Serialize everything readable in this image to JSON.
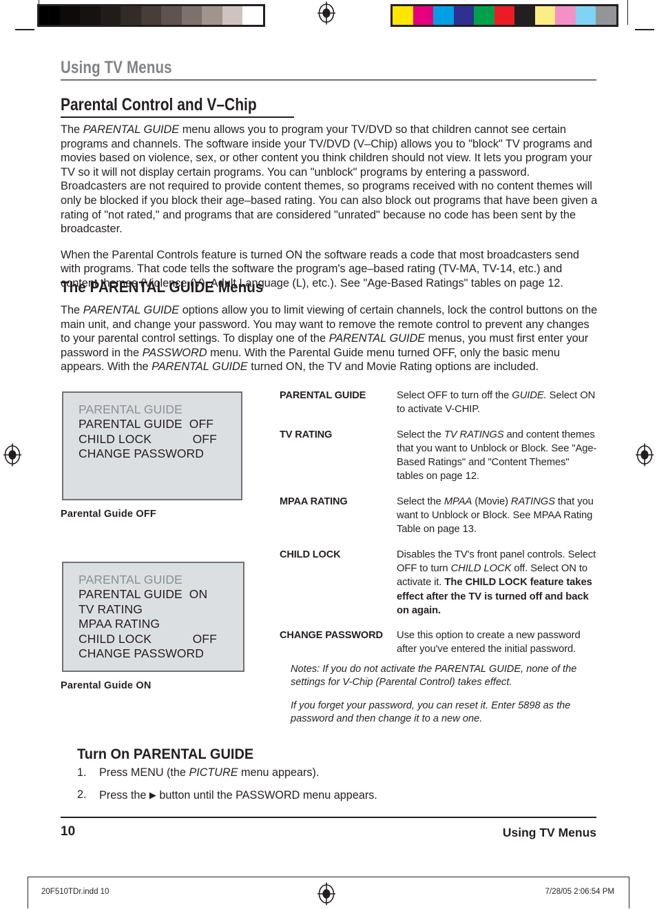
{
  "prepress": {
    "grayscale_swatches": [
      "#000000",
      "#0d0a09",
      "#161210",
      "#211c1a",
      "#332b28",
      "#473d39",
      "#5f534f",
      "#7d716c",
      "#a1948f",
      "#cfc3bf",
      "#ffffff"
    ],
    "color_swatches": [
      "#fde700",
      "#e6007e",
      "#00a0e3",
      "#2e3192",
      "#00a14b",
      "#ed1c24",
      "#231f20",
      "#fbee84",
      "#f490c8",
      "#7fd4f5",
      "#939598"
    ],
    "registration_mark": "registration-target-icon",
    "slug_left": "20F510TDr.indd   10",
    "slug_right": "7/28/05   2:06:54 PM"
  },
  "running_head": "Using TV Menus",
  "section_title": "Parental Control and V–Chip",
  "intro_paragraphs": [
    {
      "runs": [
        {
          "t": "The ",
          "i": false
        },
        {
          "t": "PARENTAL GUIDE",
          "i": true
        },
        {
          "t": " menu allows you to program your TV/DVD so that children cannot see certain programs and channels. The software inside your TV/DVD (V–Chip) allows you to \"block\" TV programs and movies based on violence, sex, or other content you think children should not view. It lets you program your TV so it will not display certain programs. You can \"unblock\" programs by entering a password. Broadcasters are not required to provide content themes, so programs received with no content themes will only be blocked if you block their age–based rating. You can also block out programs that have been given a rating of \"not rated,\" and programs that are considered \"unrated\" because no code has been sent by the broadcaster.",
          "i": false
        }
      ]
    },
    {
      "runs": [
        {
          "t": "When the Parental Controls feature is turned ON the software reads a code that most broadcasters send with programs. That code tells the software the program's age–based rating (TV-MA, TV-14, etc.) and content themes (Violence (V), Adult Language (L), etc.).  See \"Age-Based Ratings\" tables on page 12.",
          "i": false
        }
      ]
    }
  ],
  "subsection_title": "The PARENTAL GUIDE Menus",
  "subsection_paragraphs": [
    {
      "runs": [
        {
          "t": "The ",
          "i": false
        },
        {
          "t": "PARENTAL GUIDE",
          "i": true
        },
        {
          "t": " options allow you to limit viewing of certain channels, lock the control buttons on the main unit, and change your password. You may want to remove the remote control to prevent any changes to your parental control settings. To display one of the ",
          "i": false
        },
        {
          "t": "PARENTAL GUIDE",
          "i": true
        },
        {
          "t": " menus, you must first enter your password in the ",
          "i": false
        },
        {
          "t": "PASSWORD",
          "i": true
        },
        {
          "t": " menu. With the Parental Guide menu turned OFF, only the basic menu appears. With the ",
          "i": false
        },
        {
          "t": "PARENTAL GUIDE",
          "i": true
        },
        {
          "t": " turned ON, the TV and Movie Rating options are included.",
          "i": false
        }
      ]
    }
  ],
  "tv_menus": [
    {
      "id": "parental-guide-off",
      "header": "PARENTAL GUIDE",
      "rows": [
        "PARENTAL GUIDE  OFF",
        "CHILD LOCK            OFF",
        "CHANGE PASSWORD"
      ],
      "caption": "Parental Guide OFF",
      "bg_color": "#dcdfe1",
      "header_color": "#8a9097"
    },
    {
      "id": "parental-guide-on",
      "header": "PARENTAL GUIDE",
      "rows": [
        "PARENTAL GUIDE  ON",
        "TV RATING",
        "MPAA RATING",
        "CHILD LOCK            OFF",
        "CHANGE PASSWORD"
      ],
      "caption": "Parental Guide ON",
      "bg_color": "#dcdfe1",
      "header_color": "#8a9097"
    }
  ],
  "definitions": [
    {
      "term": "PARENTAL GUIDE",
      "runs": [
        {
          "t": "Select OFF to turn off the ",
          "i": false,
          "b": false
        },
        {
          "t": "GUIDE.",
          "i": true,
          "b": false
        },
        {
          "t": " Select ON to activate V-CHIP.",
          "i": false,
          "b": false
        }
      ]
    },
    {
      "term": "TV RATING",
      "runs": [
        {
          "t": "Select the ",
          "i": false,
          "b": false
        },
        {
          "t": "TV RATINGS",
          "i": true,
          "b": false
        },
        {
          "t": " and content themes that you want to Unblock or Block. See \"Age-Based Ratings\" and \"Content Themes\" tables on page 12.",
          "i": false,
          "b": false
        }
      ]
    },
    {
      "term": "MPAA RATING",
      "runs": [
        {
          "t": "Select the ",
          "i": false,
          "b": false
        },
        {
          "t": "MPAA",
          "i": true,
          "b": false
        },
        {
          "t": " (Movie) ",
          "i": false,
          "b": false
        },
        {
          "t": "RATINGS",
          "i": true,
          "b": false
        },
        {
          "t": " that you want to Unblock or Block. See MPAA Rating Table on page 13.",
          "i": false,
          "b": false
        }
      ]
    },
    {
      "term": "CHILD LOCK",
      "runs": [
        {
          "t": "Disables the TV's front panel controls. Select OFF to turn ",
          "i": false,
          "b": false
        },
        {
          "t": "CHILD LOCK",
          "i": true,
          "b": false
        },
        {
          "t": " off. Select ON to activate it. ",
          "i": false,
          "b": false
        },
        {
          "t": "The CHILD LOCK feature takes effect after the TV is turned off and back on again.",
          "i": false,
          "b": true
        }
      ]
    },
    {
      "term": "CHANGE PASSWORD",
      "runs": [
        {
          "t": "Use this option to create a new password after you've entered the initial password.",
          "i": false,
          "b": false
        }
      ]
    }
  ],
  "notes": [
    "Notes: If you do not activate the PARENTAL GUIDE, none of the settings for V-Chip (Parental Control) takes effect.",
    "If you forget your password, you can reset it. Enter 5898 as the password and then change it to a new one."
  ],
  "procedure": {
    "title": "Turn On PARENTAL GUIDE",
    "steps": [
      {
        "num": "1.",
        "runs": [
          {
            "t": "Press MENU (the ",
            "i": false
          },
          {
            "t": "PICTURE",
            "i": true
          },
          {
            "t": " menu appears).",
            "i": false
          }
        ]
      },
      {
        "num": "2.",
        "runs": [
          {
            "t": "Press the ",
            "i": false
          },
          {
            "t": "▶",
            "i": false,
            "tri": true
          },
          {
            "t": " button until the PASSWORD menu appears.",
            "i": false
          }
        ]
      }
    ]
  },
  "footer": {
    "page_number": "10",
    "section": "Using TV Menus"
  }
}
